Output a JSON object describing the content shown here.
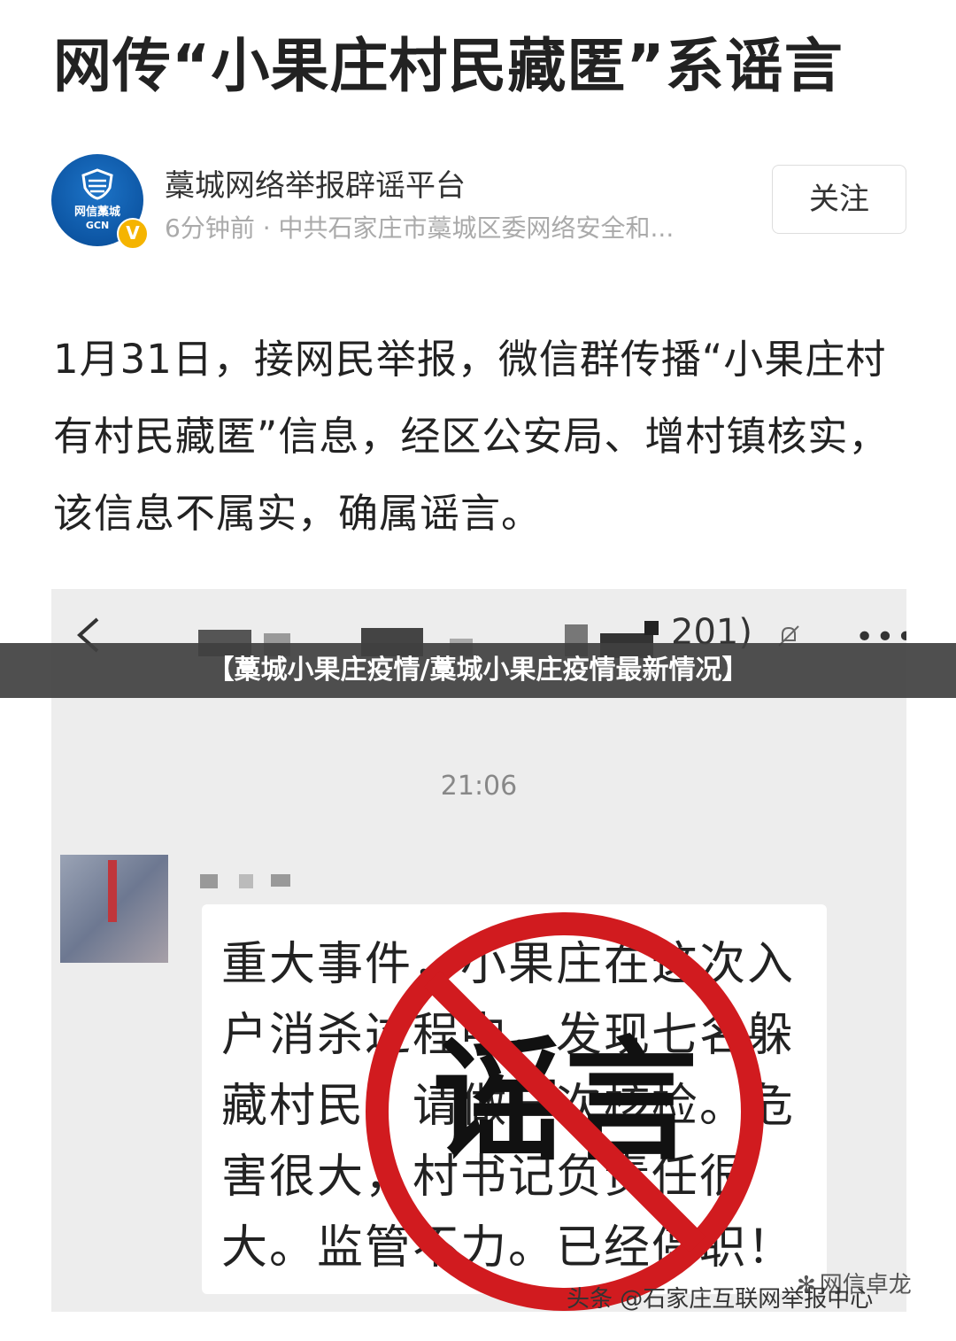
{
  "article": {
    "title": "网传“小果庄村民藏匿”系谣言",
    "author_name": "藁城网络举报辟谣平台",
    "author_meta": "6分钟前 · 中共石家庄市藁城区委网络安全和...",
    "avatar_logo_text": "网信藁城",
    "avatar_logo_sub": "GCN",
    "verified_badge": "V",
    "follow_label": "关注",
    "body": "1月31日，接网民举报，微信群传播“小果庄村有村民藏匿”信息，经区公安局、增村镇核实，该信息不属实，确属谣言。"
  },
  "screenshot": {
    "chat_title_suffix": "201)",
    "time": "21:06",
    "message": "重大事件，小果庄在这次入户消杀过程中，发现七名躲藏村民。请做一次核检。危害很大，村书记负责任很大。监管不力。已经停职！",
    "stamp_label": "谣言",
    "stamp_color": "#d11b1f",
    "icons": {
      "back": "chevron-left-icon",
      "mute": "mute-bell-icon",
      "more": "more-dots-icon"
    }
  },
  "banner": {
    "text": "【藁城小果庄疫情/藁城小果庄疫情最新情况】"
  },
  "watermarks": {
    "toutiao": "头条 @石家庄互联网举报中心",
    "wechat": "网信卓龙"
  }
}
